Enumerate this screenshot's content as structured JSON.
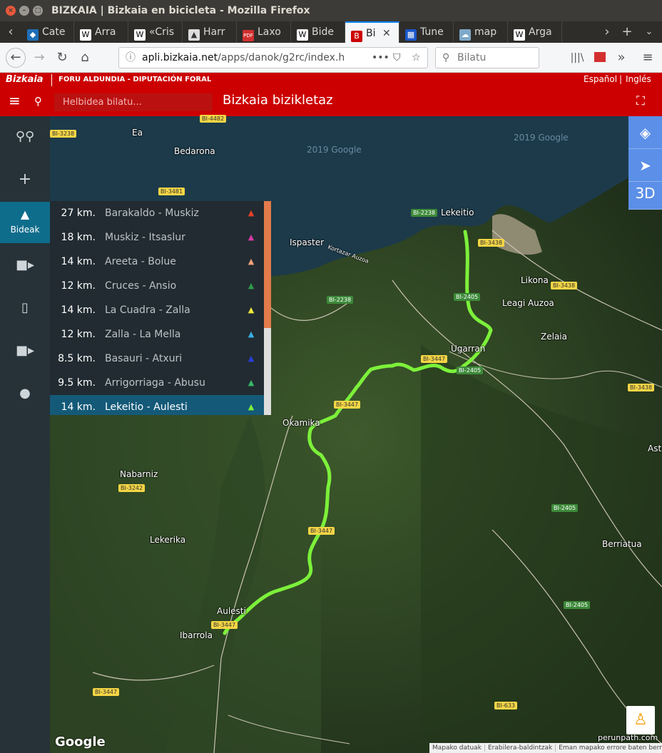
{
  "window": {
    "title": "BIZKAIA | Bizkaia en bicicleta - Mozilla Firefox"
  },
  "tabs": [
    {
      "label": "Cate",
      "icon": "wordpress-icon"
    },
    {
      "label": "Arra",
      "icon": "wikipedia-icon"
    },
    {
      "label": "«Cris",
      "icon": "wikipedia-icon"
    },
    {
      "label": "Harr",
      "icon": "peak-icon"
    },
    {
      "label": "Laxo",
      "icon": "pdf-icon"
    },
    {
      "label": "Bide",
      "icon": "wikipedia-icon"
    },
    {
      "label": "Bi",
      "icon": "bizkaia-icon",
      "active": true
    },
    {
      "label": "Tune",
      "icon": "grid-icon"
    },
    {
      "label": "map",
      "icon": "cloud-icon"
    },
    {
      "label": "Arga",
      "icon": "wikipedia-icon"
    }
  ],
  "browser": {
    "url_host": "apli.bizkaia.net",
    "url_path": "/apps/danok/g2rc/index.h",
    "search_placeholder": "Bilatu"
  },
  "gov": {
    "logo": "Bizkaia",
    "org": "FORU ALDUNDIA - DIPUTACIÓN FORAL",
    "lang_es": "Español",
    "lang_sep": "|",
    "lang_en": "Inglés"
  },
  "app": {
    "search_placeholder": "Helbidea bilatu...",
    "title": "Bizkaia bizikletaz"
  },
  "sidebar": {
    "bideak_label": "Bideak"
  },
  "routes": [
    {
      "km": "27 km.",
      "name": "Barakaldo - Muskiz",
      "color": "#e8402a"
    },
    {
      "km": "18 km.",
      "name": "Muskiz - Itsaslur",
      "color": "#d63aa8"
    },
    {
      "km": "14 km.",
      "name": "Areeta - Bolue",
      "color": "#f2a07a"
    },
    {
      "km": "12 km.",
      "name": "Cruces - Ansio",
      "color": "#2e9a4a"
    },
    {
      "km": "14 km.",
      "name": "La Cuadra - Zalla",
      "color": "#f0e83a"
    },
    {
      "km": "12 km.",
      "name": "Zalla - La Mella",
      "color": "#3ab0e8"
    },
    {
      "km": "8.5 km.",
      "name": "Basauri - Atxuri",
      "color": "#2a3ed8"
    },
    {
      "km": "9.5 km.",
      "name": "Arrigorriaga - Abusu",
      "color": "#38b86a"
    },
    {
      "km": "14 km.",
      "name": "Lekeitio - Aulesti",
      "color": "#7cf03a",
      "selected": true
    }
  ],
  "map": {
    "places": [
      {
        "name": "Ea"
      },
      {
        "name": "Bedarona"
      },
      {
        "name": "Lekeitio"
      },
      {
        "name": "Ispaster"
      },
      {
        "name": "Likona"
      },
      {
        "name": "Leagi Auzoa"
      },
      {
        "name": "Zelaia"
      },
      {
        "name": "Ugarran"
      },
      {
        "name": "Okamika"
      },
      {
        "name": "Nabarniz"
      },
      {
        "name": "Lekerika"
      },
      {
        "name": "Aulesti"
      },
      {
        "name": "Ibarrola"
      },
      {
        "name": "Berriatua"
      },
      {
        "name": "Ast"
      },
      {
        "name": "Kortazar Auzoa"
      }
    ],
    "roads": [
      "BI-3238",
      "BI-4482",
      "BI-3481",
      "BI-2238",
      "BI-3438",
      "BI-2238",
      "BI-2405",
      "BI-3438",
      "BI-2405",
      "BI-3438",
      "BI-3447",
      "BI-3242",
      "BI-3447",
      "BI-2405",
      "BI-2405",
      "BI-3447",
      "BI-633",
      "BI-3447",
      "BI-3447"
    ],
    "copyright": "2019 Google",
    "view_3d": "3D",
    "google": "Google",
    "watermark": "perunpath.com",
    "footer": [
      "Mapako datuak",
      "Erabilera-baldintzak",
      "Eman mapako errore baten berri"
    ]
  }
}
